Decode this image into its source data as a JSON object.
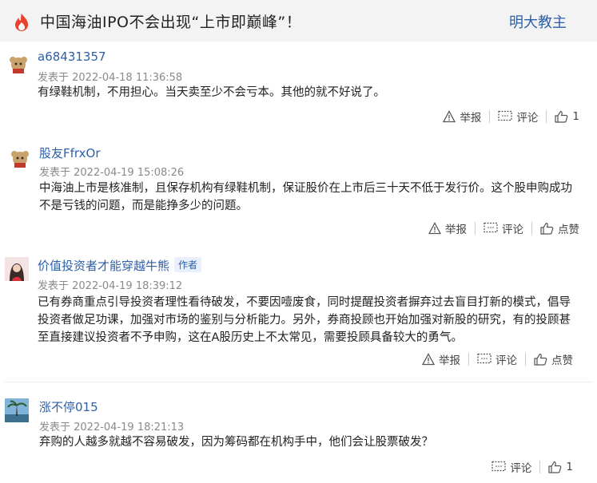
{
  "header": {
    "title": "中国海油IPO不会出现“上市即巅峰”！",
    "author": "明大教主"
  },
  "comments": [
    {
      "username": "a68431357",
      "tag": "",
      "time": "发表于 2022-04-18 11:36:58",
      "lines": [
        "有绿鞋机制，不用担心。当天卖至少不会亏本。其他的就不好说了。"
      ],
      "report": "举报",
      "reply": "评论",
      "like": "1"
    },
    {
      "username": "股友FfrxOr",
      "tag": "",
      "time": "发表于 2022-04-19 15:08:26",
      "lines": [
        "中海油上市是核准制，且保存机构有绿鞋机制，保证股价在上市后三十天不低于发行价。这个股申购成功",
        "不是亏钱的问题，而是能挣多少的问题。"
      ],
      "report": "举报",
      "reply": "评论",
      "like": "点赞"
    },
    {
      "username": "价值投资者才能穿越牛熊",
      "tag": "作者",
      "time": "发表于 2022-04-19 18:39:12",
      "lines": [
        "已有券商重点引导投资者理性看待破发，不要因噎废食，同时提醒投资者摒弃过去盲目打新的模式，倡导",
        "投资者做足功课，加强对市场的鉴别与分析能力。另外，券商投顾也开始加强对新股的研究，有的投顾甚",
        "至直接建议投资者不予申购，这在A股历史上不太常见，需要投顾具备较大的勇气。"
      ],
      "report": "举报",
      "reply": "评论",
      "like": "点赞"
    },
    {
      "username": "涨不停015",
      "tag": "",
      "time": "发表于 2022-04-19 18:21:13",
      "lines": [
        "弃购的人越多就越不容易破发，因为筹码都在机构手中，他们会让股票破发？"
      ],
      "report": "",
      "reply": "评论",
      "like": "1"
    }
  ]
}
